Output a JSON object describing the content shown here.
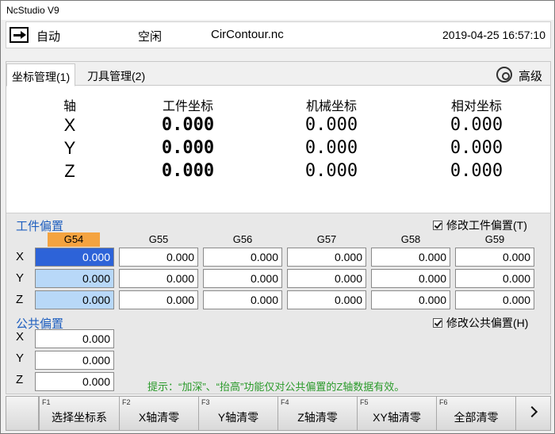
{
  "window": {
    "title": "NcStudio V9"
  },
  "status": {
    "mode": "自动",
    "state": "空闲",
    "file": "CirContour.nc",
    "datetime": "2019-04-25 16:57:10"
  },
  "tabs": [
    {
      "label": "坐标管理(1)",
      "active": true
    },
    {
      "label": "刀具管理(2)",
      "active": false
    }
  ],
  "advanced": {
    "icon": "camera-settings-icon",
    "label": "高级"
  },
  "coords": {
    "headers": {
      "axis": "轴",
      "work": "工件坐标",
      "machine": "机械坐标",
      "relative": "相对坐标"
    },
    "rows": [
      {
        "axis": "X",
        "work": "0.000",
        "machine": "0.000",
        "relative": "0.000"
      },
      {
        "axis": "Y",
        "work": "0.000",
        "machine": "0.000",
        "relative": "0.000"
      },
      {
        "axis": "Z",
        "work": "0.000",
        "machine": "0.000",
        "relative": "0.000"
      }
    ]
  },
  "work_offset": {
    "title": "工件偏置",
    "modify_label": "修改工件偏置(T)",
    "modify_checked": true,
    "columns": [
      "G54",
      "G55",
      "G56",
      "G57",
      "G58",
      "G59"
    ],
    "selected_column": "G54",
    "rows": [
      {
        "axis": "X",
        "values": [
          "0.000",
          "0.000",
          "0.000",
          "0.000",
          "0.000",
          "0.000"
        ]
      },
      {
        "axis": "Y",
        "values": [
          "0.000",
          "0.000",
          "0.000",
          "0.000",
          "0.000",
          "0.000"
        ]
      },
      {
        "axis": "Z",
        "values": [
          "0.000",
          "0.000",
          "0.000",
          "0.000",
          "0.000",
          "0.000"
        ]
      }
    ]
  },
  "common_offset": {
    "title": "公共偏置",
    "modify_label": "修改公共偏置(H)",
    "modify_checked": true,
    "rows": [
      {
        "axis": "X",
        "value": "0.000"
      },
      {
        "axis": "Y",
        "value": "0.000"
      },
      {
        "axis": "Z",
        "value": "0.000"
      }
    ]
  },
  "hint": "提示：“加深”、“抬高”功能仅对公共偏置的Z轴数据有效。",
  "function_keys": [
    {
      "key": "F1",
      "label": "选择坐标系"
    },
    {
      "key": "F2",
      "label": "X轴清零"
    },
    {
      "key": "F3",
      "label": "Y轴清零"
    },
    {
      "key": "F4",
      "label": "Z轴清零"
    },
    {
      "key": "F5",
      "label": "XY轴清零"
    },
    {
      "key": "F6",
      "label": "全部清零"
    }
  ],
  "more_icon": "chevron-right-icon",
  "colors": {
    "accent_blue": "#2d63d8",
    "selected_column": "#f4a340",
    "hint_green": "#2a9a2a",
    "section_title": "#1f5fbf"
  }
}
